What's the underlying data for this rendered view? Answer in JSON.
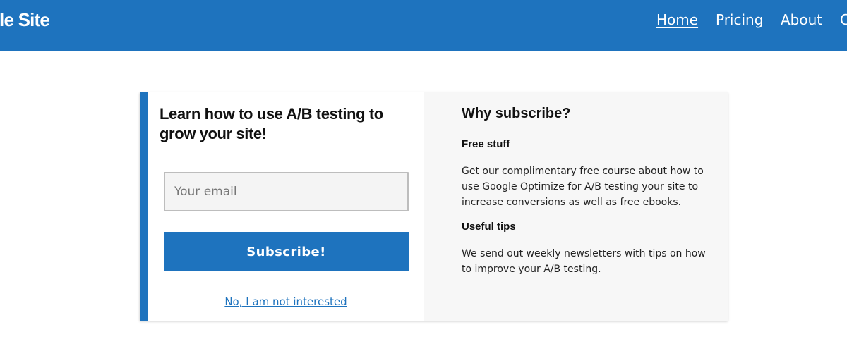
{
  "header": {
    "site_title": "ample Site",
    "nav": [
      {
        "label": "Home",
        "active": true
      },
      {
        "label": "Pricing",
        "active": false
      },
      {
        "label": "About",
        "active": false
      },
      {
        "label": "C",
        "active": false
      }
    ]
  },
  "signup": {
    "headline": "Learn how to use A/B testing to grow your site!",
    "email_placeholder": "Your email",
    "email_value": "",
    "subscribe_label": "Subscribe!",
    "decline_label": "No, I am not interested"
  },
  "benefits": {
    "title": "Why subscribe?",
    "sections": [
      {
        "heading": "Free stuff",
        "text": "Get our complimentary free course about how to use Google Optimize for A/B testing your site to increase conversions as well as free ebooks."
      },
      {
        "heading": "Useful tips",
        "text": "We send out weekly newsletters with tips on how to improve your A/B testing."
      }
    ]
  },
  "colors": {
    "brand_blue": "#1e73be",
    "panel_gray": "#f7f7f7",
    "input_bg": "#f4f4f4",
    "input_border": "#bdbdbd"
  }
}
